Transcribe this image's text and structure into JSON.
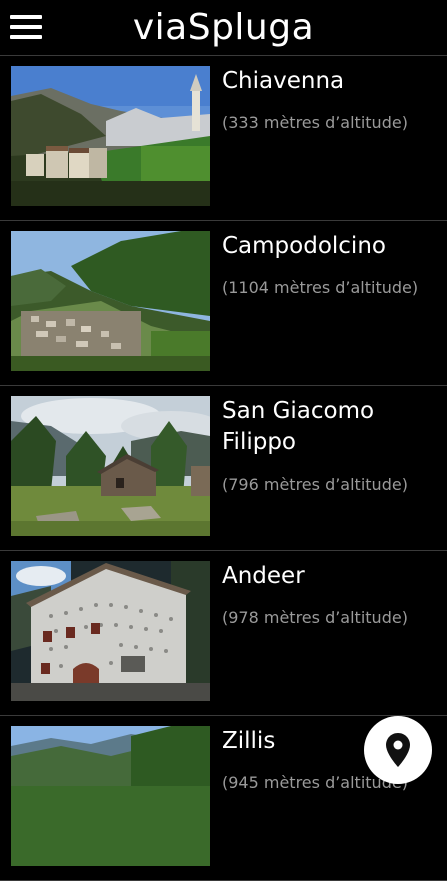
{
  "app": {
    "title": "viaSpluga",
    "menu_icon": "hamburger-menu-icon",
    "map_icon": "map-pin-icon"
  },
  "places": [
    {
      "name": "Chiavenna",
      "altitude": "(333 mètres d’altitude)"
    },
    {
      "name": "Campodolcino",
      "altitude": "(1104 mètres d’altitude)"
    },
    {
      "name": "San Giacomo Filippo",
      "altitude": "(796 mètres d’altitude)"
    },
    {
      "name": "Andeer",
      "altitude": "(978 mètres d’altitude)"
    },
    {
      "name": "Zillis",
      "altitude": "(945 mètres d’altitude)"
    }
  ]
}
